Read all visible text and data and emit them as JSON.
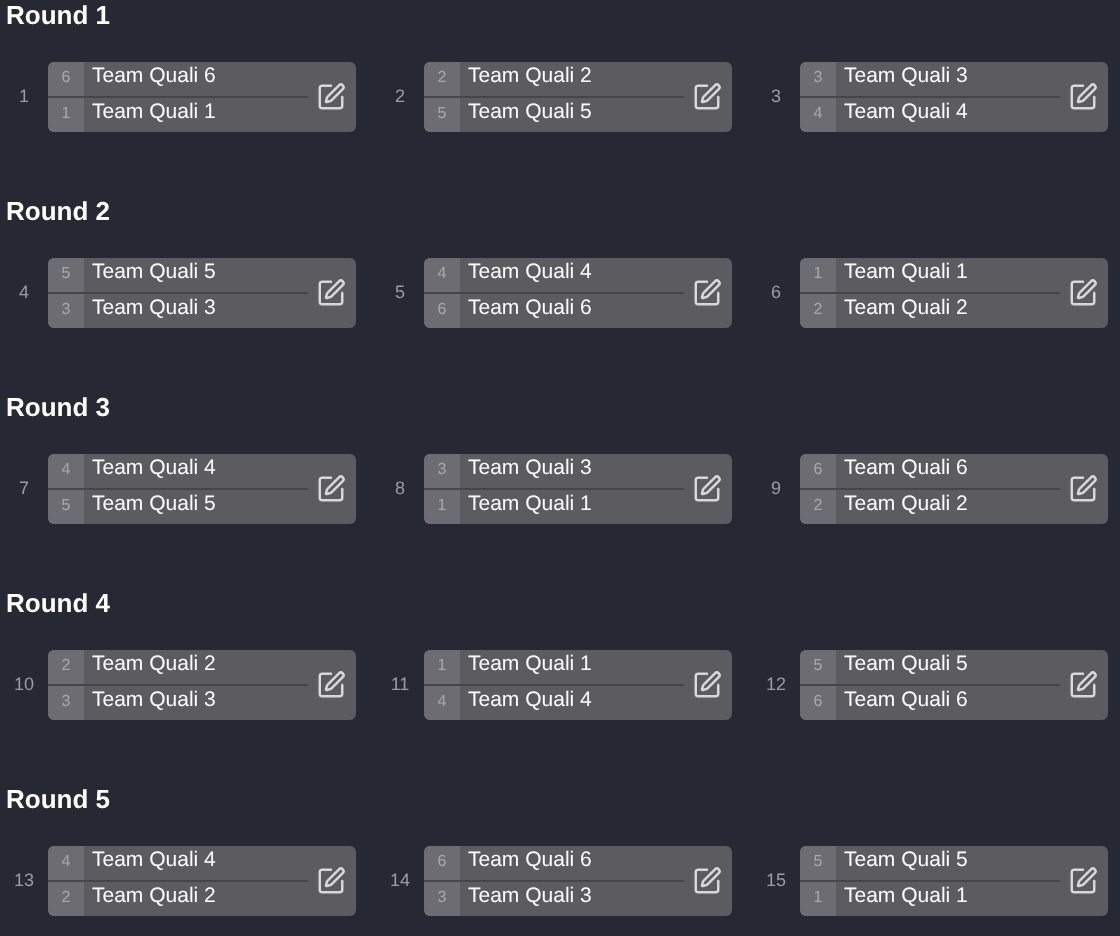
{
  "rounds": [
    {
      "title": "Round 1",
      "matches": [
        {
          "number": "1",
          "teams": [
            {
              "seed": "6",
              "name": "Team Quali 6"
            },
            {
              "seed": "1",
              "name": "Team Quali 1"
            }
          ]
        },
        {
          "number": "2",
          "teams": [
            {
              "seed": "2",
              "name": "Team Quali 2"
            },
            {
              "seed": "5",
              "name": "Team Quali 5"
            }
          ]
        },
        {
          "number": "3",
          "teams": [
            {
              "seed": "3",
              "name": "Team Quali 3"
            },
            {
              "seed": "4",
              "name": "Team Quali 4"
            }
          ]
        }
      ]
    },
    {
      "title": "Round 2",
      "matches": [
        {
          "number": "4",
          "teams": [
            {
              "seed": "5",
              "name": "Team Quali 5"
            },
            {
              "seed": "3",
              "name": "Team Quali 3"
            }
          ]
        },
        {
          "number": "5",
          "teams": [
            {
              "seed": "4",
              "name": "Team Quali 4"
            },
            {
              "seed": "6",
              "name": "Team Quali 6"
            }
          ]
        },
        {
          "number": "6",
          "teams": [
            {
              "seed": "1",
              "name": "Team Quali 1"
            },
            {
              "seed": "2",
              "name": "Team Quali 2"
            }
          ]
        }
      ]
    },
    {
      "title": "Round 3",
      "matches": [
        {
          "number": "7",
          "teams": [
            {
              "seed": "4",
              "name": "Team Quali 4"
            },
            {
              "seed": "5",
              "name": "Team Quali 5"
            }
          ]
        },
        {
          "number": "8",
          "teams": [
            {
              "seed": "3",
              "name": "Team Quali 3"
            },
            {
              "seed": "1",
              "name": "Team Quali 1"
            }
          ]
        },
        {
          "number": "9",
          "teams": [
            {
              "seed": "6",
              "name": "Team Quali 6"
            },
            {
              "seed": "2",
              "name": "Team Quali 2"
            }
          ]
        }
      ]
    },
    {
      "title": "Round 4",
      "matches": [
        {
          "number": "10",
          "teams": [
            {
              "seed": "2",
              "name": "Team Quali 2"
            },
            {
              "seed": "3",
              "name": "Team Quali 3"
            }
          ]
        },
        {
          "number": "11",
          "teams": [
            {
              "seed": "1",
              "name": "Team Quali 1"
            },
            {
              "seed": "4",
              "name": "Team Quali 4"
            }
          ]
        },
        {
          "number": "12",
          "teams": [
            {
              "seed": "5",
              "name": "Team Quali 5"
            },
            {
              "seed": "6",
              "name": "Team Quali 6"
            }
          ]
        }
      ]
    },
    {
      "title": "Round 5",
      "matches": [
        {
          "number": "13",
          "teams": [
            {
              "seed": "4",
              "name": "Team Quali 4"
            },
            {
              "seed": "2",
              "name": "Team Quali 2"
            }
          ]
        },
        {
          "number": "14",
          "teams": [
            {
              "seed": "6",
              "name": "Team Quali 6"
            },
            {
              "seed": "3",
              "name": "Team Quali 3"
            }
          ]
        },
        {
          "number": "15",
          "teams": [
            {
              "seed": "5",
              "name": "Team Quali 5"
            },
            {
              "seed": "1",
              "name": "Team Quali 1"
            }
          ]
        }
      ]
    }
  ]
}
